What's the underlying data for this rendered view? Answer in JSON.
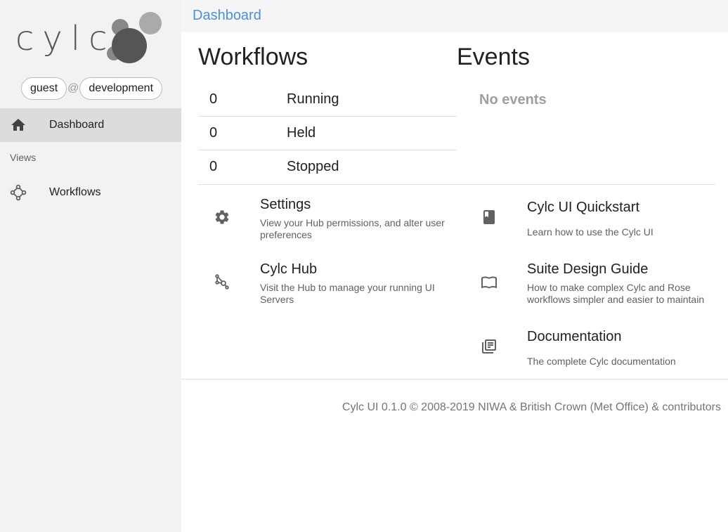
{
  "sidebar": {
    "logo_text": "cylc",
    "user": "guest",
    "at_symbol": "@",
    "environment": "development",
    "items": [
      {
        "label": "Dashboard",
        "icon": "home-icon",
        "active": true
      },
      {
        "label": "Workflows",
        "icon": "workflows-icon",
        "active": false
      }
    ],
    "views_header": "Views"
  },
  "header": {
    "title": "Dashboard"
  },
  "workflows": {
    "heading": "Workflows",
    "rows": [
      {
        "count": "0",
        "state": "Running"
      },
      {
        "count": "0",
        "state": "Held"
      },
      {
        "count": "0",
        "state": "Stopped"
      }
    ]
  },
  "events": {
    "heading": "Events",
    "empty_text": "No events"
  },
  "links": {
    "settings": {
      "title": "Settings",
      "desc": "View your Hub permissions, and alter user preferences",
      "icon": "gear-icon"
    },
    "hub": {
      "title": "Cylc Hub",
      "desc": "Visit the Hub to manage your running UI Servers",
      "icon": "hub-icon"
    },
    "quickstart": {
      "title": "Cylc UI Quickstart",
      "desc": "Learn how to use the Cylc UI",
      "icon": "book-icon"
    },
    "design_guide": {
      "title": "Suite Design Guide",
      "desc": "How to make complex Cylc and Rose workflows simpler and easier to maintain",
      "icon": "open-book-icon"
    },
    "docs": {
      "title": "Documentation",
      "desc": "The complete Cylc documentation",
      "icon": "library-books-icon"
    }
  },
  "footer": {
    "text": "Cylc UI 0.1.0 © 2008-2019 NIWA & British Crown (Met Office) & contributors"
  },
  "colors": {
    "accent": "#4a8fe0",
    "sidebar_bg": "#f2f2f2",
    "active_bg": "#dcdcdc"
  }
}
